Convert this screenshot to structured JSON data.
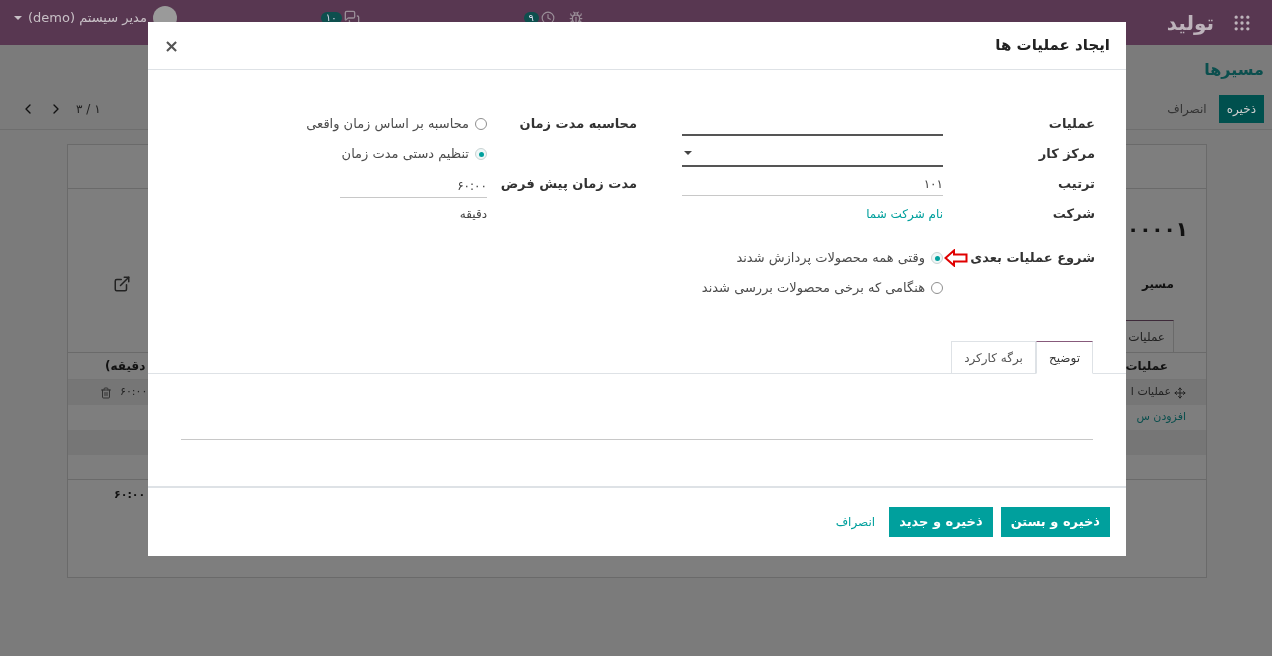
{
  "top_bar": {
    "app_name": "تولید",
    "activity_count": "۹",
    "message_count": "۱۰",
    "user": "مدیر سیستم (demo)"
  },
  "breadcrumb": [
    "مسیرها"
  ],
  "control_panel": {
    "save": "ذخیره",
    "discard": "انصراف",
    "pager": "۱ / ۳"
  },
  "record": {
    "title": "۰۰۰۰۱",
    "field_label": "مسیر",
    "tabs": [
      {
        "label": "عملیات",
        "selected": true
      }
    ],
    "column_1": "عملیات",
    "column_2": "دقیقه)",
    "row": {
      "name": "عملیات ا",
      "duration": "۶۰:۰۰"
    },
    "add_line": "افزودن س",
    "total": "۶۰:۰۰"
  },
  "dialog": {
    "title": "ایجاد عملیات ها",
    "close": "×",
    "fields": [
      {
        "label": "عملیات",
        "kind": "input"
      },
      {
        "label": "مرکز کار",
        "kind": "select"
      },
      {
        "label": "ترتیب",
        "kind": "input",
        "value": "۱۰۱"
      },
      {
        "label": "شرکت",
        "kind": "link",
        "value": "نام شرکت شما"
      }
    ],
    "duration_computation": {
      "label": "محاسبه مدت زمان",
      "options": [
        {
          "label": "محاسبه بر اساس زمان واقعی",
          "selected": false
        },
        {
          "label": "تنظیم دستی مدت زمان",
          "selected": true
        }
      ]
    },
    "default_duration": {
      "label": "مدت زمان پیش فرض",
      "value": "۶۰:۰۰",
      "unit": "دقیقه"
    },
    "start_next": {
      "label": "شروع عملیات بعدی",
      "options": [
        {
          "label": "وقتی همه محصولات پردازش شدند",
          "selected": true
        },
        {
          "label": "هنگامی که برخی محصولات بررسی شدند",
          "selected": false
        }
      ]
    },
    "tabs": [
      {
        "label": "توضیح",
        "selected": true
      },
      {
        "label": "برگه کارکرد",
        "selected": false
      }
    ],
    "buttons": [
      {
        "label": "ذخیره و بستن",
        "kind": "primary"
      },
      {
        "label": "ذخیره و جدید",
        "kind": "primary"
      },
      {
        "label": "انصراف",
        "kind": "link"
      }
    ]
  }
}
